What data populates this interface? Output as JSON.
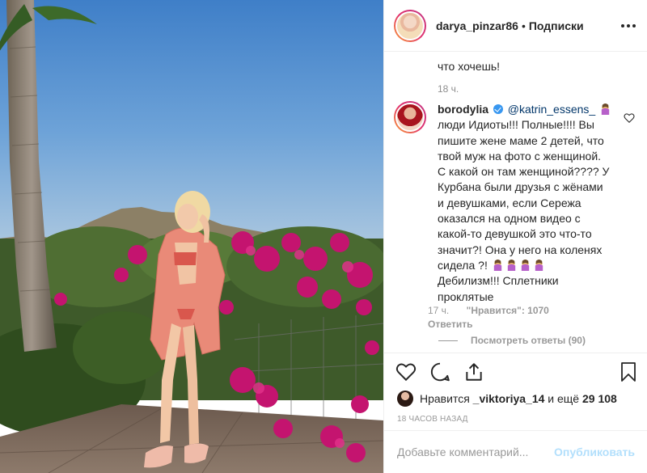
{
  "post": {
    "author": "darya_pinzar86",
    "separator": "•",
    "follow_label": "Подписки",
    "more_icon": "more-horizontal-icon"
  },
  "previous_comment": {
    "tail_text": "что хочешь!",
    "time": "18 ч."
  },
  "comment": {
    "username": "borodylia",
    "verified": true,
    "mention": "@katrin_essens_",
    "text_lines": [
      "люди Идиоты!!! Полные!!!! Вы",
      "пишите жене маме 2 детей, что",
      "твой муж на фото с женщиной.",
      "С какой он там женщиной???? У",
      "Курбана были друзья с жёнами",
      "и девушками, если Сережа",
      "оказался на одном видео с",
      "какой-то девушкой это что-то",
      "значит?! Она у него на коленях",
      "сидела ?!"
    ],
    "end_line_1": "Дебилизм!!! Сплетники",
    "end_line_2": "проклятые",
    "time": "17 ч.",
    "likes_label": "\"Нравится\": 1070",
    "reply_label": "Ответить",
    "view_replies": "Посмотреть ответы (90)",
    "emoji_name": "woman-facepalming-emoji"
  },
  "actions": {
    "like_icon": "heart-icon",
    "comment_icon": "comment-icon",
    "share_icon": "share-icon",
    "save_icon": "bookmark-icon"
  },
  "likes": {
    "prefix": "Нравится",
    "user": "_viktoriya_14",
    "middle": "и ещё",
    "count": "29 108"
  },
  "timestamp": "18 ЧАСОВ НАЗАД",
  "comment_input": {
    "placeholder": "Добавьте комментарий...",
    "publish_label": "Опубликовать"
  },
  "colors": {
    "accent_link": "#003569",
    "verified": "#3897f0",
    "publish_disabled": "#b2dffc",
    "muted": "#999999"
  }
}
